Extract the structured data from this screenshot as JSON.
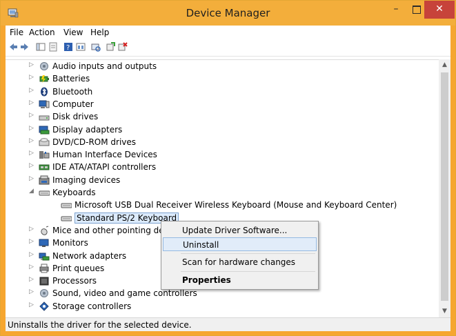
{
  "window": {
    "title": "Device Manager"
  },
  "titlebar": {
    "minimize_glyph": "–",
    "close_glyph": "✕"
  },
  "menu": [
    "File",
    "Action",
    "View",
    "Help"
  ],
  "tree": {
    "items": [
      {
        "label": "Audio inputs and outputs",
        "icon": "speaker-icon",
        "expanded": false
      },
      {
        "label": "Batteries",
        "icon": "battery-icon",
        "expanded": false
      },
      {
        "label": "Bluetooth",
        "icon": "bluetooth-icon",
        "expanded": false
      },
      {
        "label": "Computer",
        "icon": "computer-icon",
        "expanded": false
      },
      {
        "label": "Disk drives",
        "icon": "disk-drive-icon",
        "expanded": false
      },
      {
        "label": "Display adapters",
        "icon": "display-adapter-icon",
        "expanded": false
      },
      {
        "label": "DVD/CD-ROM drives",
        "icon": "dvd-drive-icon",
        "expanded": false
      },
      {
        "label": "Human Interface Devices",
        "icon": "hid-icon",
        "expanded": false
      },
      {
        "label": "IDE ATA/ATAPI controllers",
        "icon": "ide-controller-icon",
        "expanded": false
      },
      {
        "label": "Imaging devices",
        "icon": "imaging-device-icon",
        "expanded": false
      },
      {
        "label": "Keyboards",
        "icon": "keyboard-icon",
        "expanded": true
      },
      {
        "label": "Microsoft USB Dual Receiver Wireless Keyboard (Mouse and Keyboard Center)",
        "icon": "keyboard-icon",
        "child": true
      },
      {
        "label": "Standard PS/2 Keyboard",
        "icon": "keyboard-icon",
        "child": true,
        "selected": true
      },
      {
        "label": "Mice and other pointing dev",
        "icon": "mouse-icon",
        "expanded": false
      },
      {
        "label": "Monitors",
        "icon": "monitor-icon",
        "expanded": false
      },
      {
        "label": "Network adapters",
        "icon": "network-adapter-icon",
        "expanded": false
      },
      {
        "label": "Print queues",
        "icon": "printer-icon",
        "expanded": false
      },
      {
        "label": "Processors",
        "icon": "processor-icon",
        "expanded": false
      },
      {
        "label": "Sound, video and game controllers",
        "icon": "sound-icon",
        "expanded": false
      },
      {
        "label": "Storage controllers",
        "icon": "storage-controller-icon",
        "expanded": false
      }
    ]
  },
  "context_menu": {
    "items": [
      {
        "label": "Update Driver Software..."
      },
      {
        "label": "Uninstall",
        "highlighted": true
      },
      {
        "label": "Scan for hardware changes"
      },
      {
        "label": "Properties",
        "bold": true
      }
    ]
  },
  "statusbar": {
    "text": "Uninstalls the driver for the selected device."
  },
  "colors": {
    "title_bar": "#f3ae3b",
    "close_button": "#c7433a",
    "selection": "#dcebfc",
    "menu_highlight": "#e1ecf9"
  }
}
